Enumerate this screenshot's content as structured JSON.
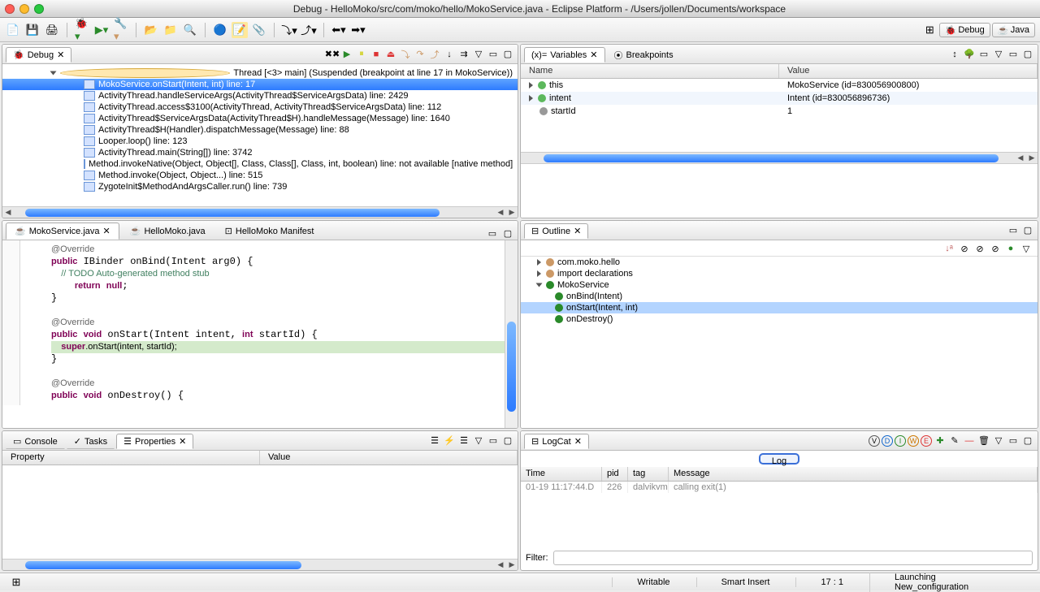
{
  "window": {
    "title": "Debug - HelloMoko/src/com/moko/hello/MokoService.java - Eclipse Platform - /Users/jollen/Documents/workspace"
  },
  "perspectives": {
    "debug": "Debug",
    "java": "Java"
  },
  "debug_view": {
    "tab": "Debug",
    "thread": "Thread [<3> main] (Suspended (breakpoint at line 17 in MokoService))",
    "frames": [
      "MokoService.onStart(Intent, int) line: 17",
      "ActivityThread.handleServiceArgs(ActivityThread$ServiceArgsData) line: 2429",
      "ActivityThread.access$3100(ActivityThread, ActivityThread$ServiceArgsData) line: 112",
      "ActivityThread$ServiceArgsData(ActivityThread$H).handleMessage(Message) line: 1640",
      "ActivityThread$H(Handler).dispatchMessage(Message) line: 88",
      "Looper.loop() line: 123",
      "ActivityThread.main(String[]) line: 3742",
      "Method.invokeNative(Object, Object[], Class, Class[], Class, int, boolean) line: not available [native method]",
      "Method.invoke(Object, Object...) line: 515",
      "ZygoteInit$MethodAndArgsCaller.run() line: 739"
    ]
  },
  "vars_view": {
    "tab_vars": "Variables",
    "tab_bp": "Breakpoints",
    "col_name": "Name",
    "col_value": "Value",
    "rows": [
      {
        "name": "this",
        "value": "MokoService  (id=830056900800)"
      },
      {
        "name": "intent",
        "value": "Intent  (id=830056896736)"
      },
      {
        "name": "startId",
        "value": "1"
      }
    ]
  },
  "editor": {
    "tabs": [
      {
        "label": "MokoService.java",
        "active": true
      },
      {
        "label": "HelloMoko.java",
        "active": false
      },
      {
        "label": "HelloMoko Manifest",
        "active": false
      }
    ],
    "code_lines": [
      {
        "t": "@Override",
        "cls": "an"
      },
      {
        "t": "public IBinder onBind(Intent arg0) {",
        "cls": ""
      },
      {
        "t": "    // TODO Auto-generated method stub",
        "cls": "cm"
      },
      {
        "t": "    return null;",
        "cls": ""
      },
      {
        "t": "}",
        "cls": ""
      },
      {
        "t": "",
        "cls": ""
      },
      {
        "t": "@Override",
        "cls": "an"
      },
      {
        "t": "public void onStart(Intent intent, int startId) {",
        "cls": ""
      },
      {
        "t": "    super.onStart(intent, startId);",
        "cls": "hl"
      },
      {
        "t": "}",
        "cls": ""
      },
      {
        "t": "",
        "cls": ""
      },
      {
        "t": "@Override",
        "cls": "an"
      },
      {
        "t": "public void onDestroy() {",
        "cls": ""
      }
    ]
  },
  "outline": {
    "tab": "Outline",
    "items": [
      {
        "label": "com.moko.hello",
        "lvl": 1,
        "type": "pkg"
      },
      {
        "label": "import declarations",
        "lvl": 1,
        "type": "imp"
      },
      {
        "label": "MokoService",
        "lvl": 1,
        "type": "class"
      },
      {
        "label": "onBind(Intent)",
        "lvl": 2,
        "type": "method"
      },
      {
        "label": "onStart(Intent, int)",
        "lvl": 2,
        "type": "method",
        "sel": true
      },
      {
        "label": "onDestroy()",
        "lvl": 2,
        "type": "method"
      }
    ]
  },
  "props_view": {
    "tab_console": "Console",
    "tab_tasks": "Tasks",
    "tab_props": "Properties",
    "col_prop": "Property",
    "col_val": "Value"
  },
  "logcat": {
    "tab": "LogCat",
    "log_btn": "Log",
    "cols": {
      "time": "Time",
      "pid": "pid",
      "tag": "tag",
      "msg": "Message"
    },
    "row": {
      "time": "01-19 11:17:44.D",
      "pid": "226",
      "tag": "dalvikvm",
      "msg": "calling exit(1)"
    },
    "filter_label": "Filter:"
  },
  "status": {
    "writable": "Writable",
    "insert": "Smart Insert",
    "pos": "17 : 1",
    "launch": "Launching New_configuration"
  }
}
